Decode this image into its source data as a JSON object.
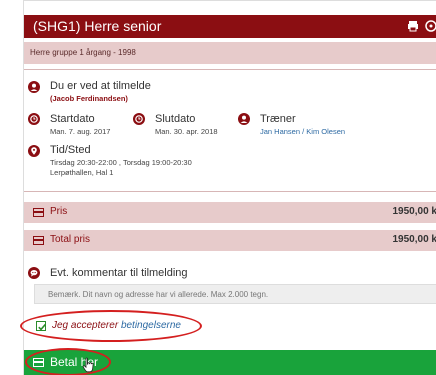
{
  "header": {
    "title": "(SHG1) Herre senior",
    "icons": [
      "print-icon",
      "more-icon"
    ]
  },
  "subheader": {
    "text": "Herre gruppe 1 årgang - 1998"
  },
  "registration": {
    "title": "Du er ved at tilmelde",
    "person": "(Jacob Ferdinandsen)"
  },
  "dates": {
    "start_label": "Startdato",
    "start_value": "Man. 7. aug. 2017",
    "end_label": "Slutdato",
    "end_value": "Man. 30. apr. 2018",
    "coach_label": "Træner",
    "coach_value": "Jan Hansen / Kim Olesen"
  },
  "time_place": {
    "label": "Tid/Sted",
    "line1": "Tirsdag 20:30-22:00 , Torsdag 19:00-20:30",
    "line2": "Lerpøthallen, Hal 1"
  },
  "pricing": {
    "price_label": "Pris",
    "price_value": "1950,00 k",
    "total_label": "Total pris",
    "total_value": "1950,00 k"
  },
  "comment": {
    "label": "Evt. kommentar til tilmelding",
    "placeholder": "Bemærk. Dit navn og adresse har vi allerede. Max 2.000 tegn."
  },
  "terms": {
    "prefix": "Jeg accepterer ",
    "link": "betingelserne",
    "checked": true
  },
  "pay": {
    "label": "Betal her"
  },
  "colors": {
    "primary": "#8b0e12",
    "light": "#e7cbcb",
    "green": "#19a33b",
    "annotation": "#d41f1f",
    "link": "#2d6aa3"
  }
}
